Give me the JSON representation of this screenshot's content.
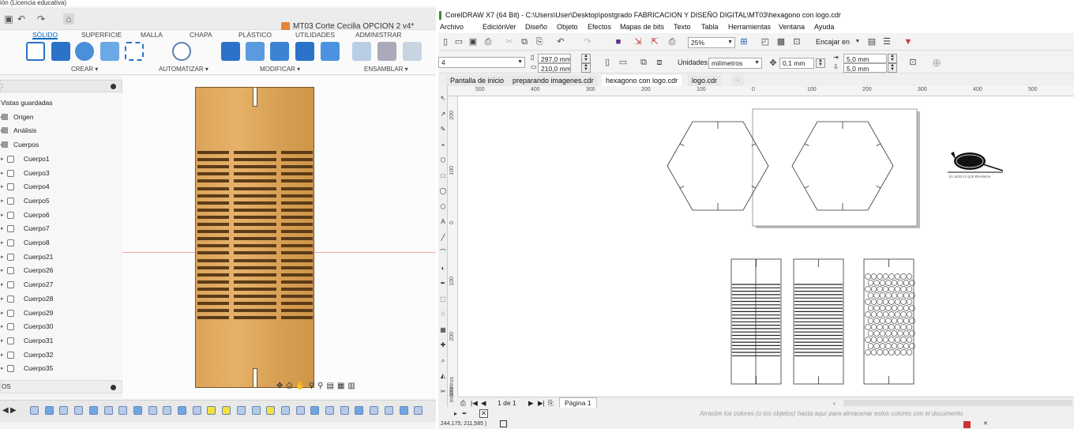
{
  "fusion": {
    "window_title": "ión (Licencia educativa)",
    "document_title": "MT03 Corte Cecilia OPCION 2 v4*",
    "tabs": [
      "SÓLIDO",
      "SUPERFICIE",
      "MALLA",
      "CHAPA",
      "PLÁSTICO",
      "UTILIDADES",
      "ADMINISTRAR"
    ],
    "groups": [
      "CREAR ▾",
      "AUTOMATIZAR ▾",
      "MODIFICAR ▾",
      "ENSAMBLAR ▾"
    ],
    "browser_header": ":",
    "browser_items": [
      {
        "label": "Vistas guardadas",
        "kind": "folder0"
      },
      {
        "label": "Origen",
        "kind": "folder"
      },
      {
        "label": "Análisis",
        "kind": "folder"
      },
      {
        "label": "Cuerpos",
        "kind": "folder"
      },
      {
        "label": "Cuerpo1",
        "kind": "body"
      },
      {
        "label": "Cuerpo3",
        "kind": "body"
      },
      {
        "label": "Cuerpo4",
        "kind": "body"
      },
      {
        "label": "Cuerpo5",
        "kind": "body"
      },
      {
        "label": "Cuerpo6",
        "kind": "body"
      },
      {
        "label": "Cuerpo7",
        "kind": "body"
      },
      {
        "label": "Cuerpo8",
        "kind": "body"
      },
      {
        "label": "Cuerpo21",
        "kind": "body"
      },
      {
        "label": "Cuerpo26",
        "kind": "body"
      },
      {
        "label": "Cuerpo27",
        "kind": "body"
      },
      {
        "label": "Cuerpo28",
        "kind": "body"
      },
      {
        "label": "Cuerpo29",
        "kind": "body"
      },
      {
        "label": "Cuerpo30",
        "kind": "body"
      },
      {
        "label": "Cuerpo31",
        "kind": "body"
      },
      {
        "label": "Cuerpo32",
        "kind": "body"
      },
      {
        "label": "Cuerpo35",
        "kind": "body"
      }
    ],
    "browser_footer": "OS",
    "model_color": "#dba45a"
  },
  "corel": {
    "title": "CorelDRAW X7 (64 Bit) - C:\\Users\\User\\Desktop\\postgrado FABRICACION Y DISEÑO DIGITAL\\MT03\\hexagono con logo.cdr",
    "menu": [
      "Archivo",
      "Edición",
      "Ver",
      "Diseño",
      "Objeto",
      "Efectos",
      "Mapas de bits",
      "Texto",
      "Tabla",
      "Herramientas",
      "Ventana",
      "Ayuda"
    ],
    "zoom": "25%",
    "snap_label": "Encajar en",
    "page_size_label": "4",
    "width": "297,0 mm",
    "height": "210,0 mm",
    "units_label": "Unidades:",
    "units_value": "milímetros",
    "nudge": "0,1 mm",
    "dup_x": "5,0 mm",
    "dup_y": "5,0 mm",
    "doc_tabs": [
      "Pantalla de inicio",
      "preparando imagenes.cdr",
      "hexagono con logo.cdr",
      "logo.cdr"
    ],
    "active_tab": 2,
    "ruler_h": [
      "500",
      "400",
      "300",
      "200",
      "100",
      "0",
      "100",
      "200",
      "300",
      "400",
      "500"
    ],
    "ruler_v": [
      "200",
      "100",
      "0",
      "100",
      "200",
      "300"
    ],
    "ruler_unit": "milímetros",
    "page_counter": "1 de 1",
    "page_tab": "Página 1",
    "palette_hint": "Arrastre los colores (o los objetos) hasta aquí para almacenar estos colores con el documento",
    "coords": "244,175; 211,585 )",
    "logo_text": "EL SUELO QUE PISAMOS"
  }
}
